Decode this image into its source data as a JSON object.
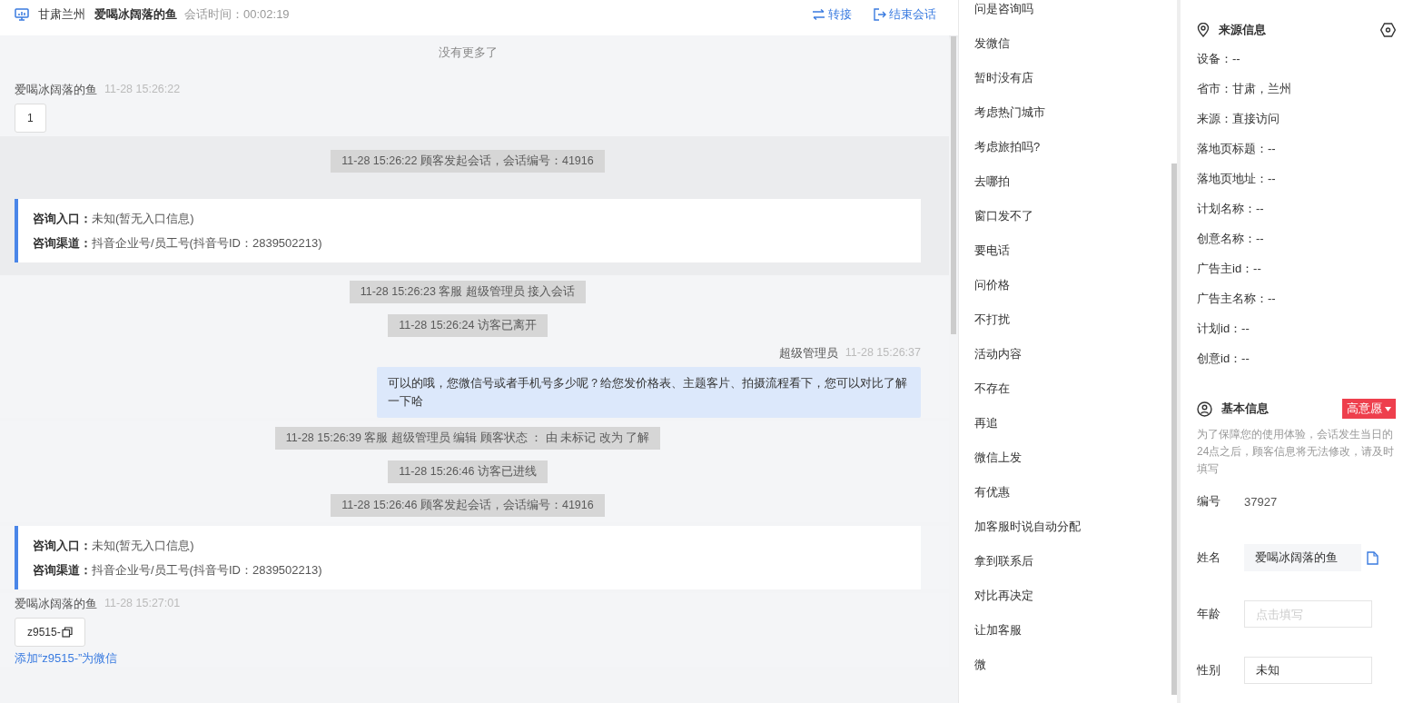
{
  "header": {
    "location": "甘肃兰州",
    "visitor": "爱喝冰阔落的鱼",
    "duration": "会话时间：00:02:19",
    "actions": [
      {
        "kind": "transfer",
        "label": "转接"
      },
      {
        "kind": "end",
        "label": "结束会话"
      }
    ]
  },
  "chat": [
    {
      "kind": "notice",
      "text": "没有更多了",
      "highlighted": false
    },
    {
      "kind": "customer",
      "sender": "爱喝冰阔落的鱼",
      "time": "11-28 15:26:22",
      "text": "1",
      "highlighted": false
    },
    {
      "kind": "system",
      "text": "11-28 15:26:22 顾客发起会话，会话编号：41916",
      "highlighted": true
    },
    {
      "kind": "entry",
      "rows": [
        {
          "label": "咨询入口：",
          "value": "未知(暂无入口信息)"
        },
        {
          "label": "咨询渠道：",
          "value": "抖音企业号/员工号(抖音号ID：2839502213)"
        }
      ],
      "highlighted": true
    },
    {
      "kind": "system",
      "text": "11-28 15:26:23 客服 超级管理员 接入会话",
      "highlighted": false
    },
    {
      "kind": "system",
      "text": "11-28 15:26:24 访客已离开",
      "highlighted": false
    },
    {
      "kind": "agent",
      "sender": "超级管理员",
      "time": "11-28 15:26:37",
      "text": "可以的哦，您微信号或者手机号多少呢？给您发价格表、主题客片、拍摄流程看下，您可以对比了解一下哈",
      "highlighted": false
    },
    {
      "kind": "system",
      "text": "11-28 15:26:39 客服 超级管理员 编辑 顾客状态 ： 由 未标记 改为 了解",
      "highlighted": false
    },
    {
      "kind": "system",
      "text": "11-28 15:26:46 访客已进线",
      "highlighted": false
    },
    {
      "kind": "system",
      "text": "11-28 15:26:46 顾客发起会话，会话编号：41916",
      "highlighted": false
    },
    {
      "kind": "entry",
      "rows": [
        {
          "label": "咨询入口：",
          "value": "未知(暂无入口信息)"
        },
        {
          "label": "咨询渠道：",
          "value": "抖音企业号/员工号(抖音号ID：2839502213)"
        }
      ],
      "highlighted": false
    },
    {
      "kind": "customer",
      "sender": "爱喝冰阔落的鱼",
      "time": "11-28 15:27:01",
      "text": "z9515-",
      "copyable": true,
      "link": "添加“z9515-”为微信",
      "highlighted": false
    }
  ],
  "quick_replies": [
    "问是咨询吗",
    "发微信",
    "暂时没有店",
    "考虑热门城市",
    "考虑旅拍吗?",
    "去哪拍",
    "窗口发不了",
    "要电话",
    "问价格",
    "不打扰",
    "活动内容",
    "不存在",
    "再追",
    "微信上发",
    "有优惠",
    "加客服时说自动分配",
    "拿到联系后",
    "对比再决定",
    "让加客服",
    "微"
  ],
  "source_info": {
    "title": "来源信息",
    "items": [
      "设备：--",
      "省市：甘肃，兰州",
      "来源：直接访问",
      "落地页标题：--",
      "落地页地址：--",
      "计划名称：--",
      "创意名称：--",
      "广告主id：--",
      "广告主名称：--",
      "计划id：--",
      "创意id：--"
    ]
  },
  "basic_info": {
    "title": "基本信息",
    "intent_tag": "高意愿",
    "hint": "为了保障您的使用体验，会话发生当日的24点之后，顾客信息将无法修改，请及时填写",
    "fields": [
      {
        "kind": "text",
        "label": "编号",
        "value": "37927"
      },
      {
        "kind": "filled",
        "label": "姓名",
        "value": "爱喝冰阔落的鱼"
      },
      {
        "kind": "input",
        "label": "年龄",
        "placeholder": "点击填写"
      },
      {
        "kind": "input",
        "label": "性别",
        "value": "未知"
      }
    ]
  }
}
